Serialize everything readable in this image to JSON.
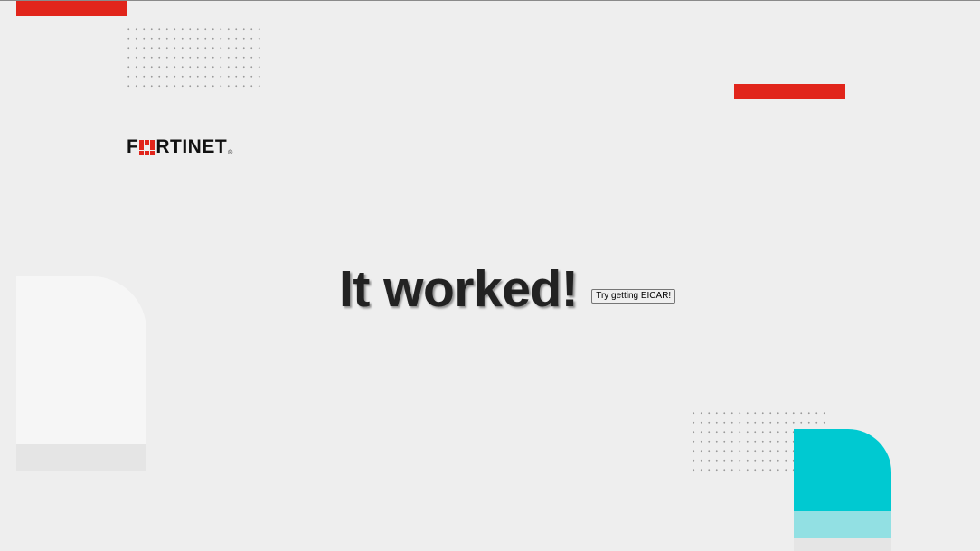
{
  "brand": {
    "logo_text_left": "F",
    "logo_text_right": "RTINET",
    "logo_registered": "®",
    "logo_name": "fortinet-logo"
  },
  "main": {
    "headline": "It worked!",
    "eicar_button_label": "Try getting EICAR!"
  },
  "colors": {
    "background": "#eeeeee",
    "accent_red": "#e1251b",
    "accent_teal": "#00c9d1",
    "accent_teal_light": "#92e0e3",
    "headline_text": "#222222"
  }
}
